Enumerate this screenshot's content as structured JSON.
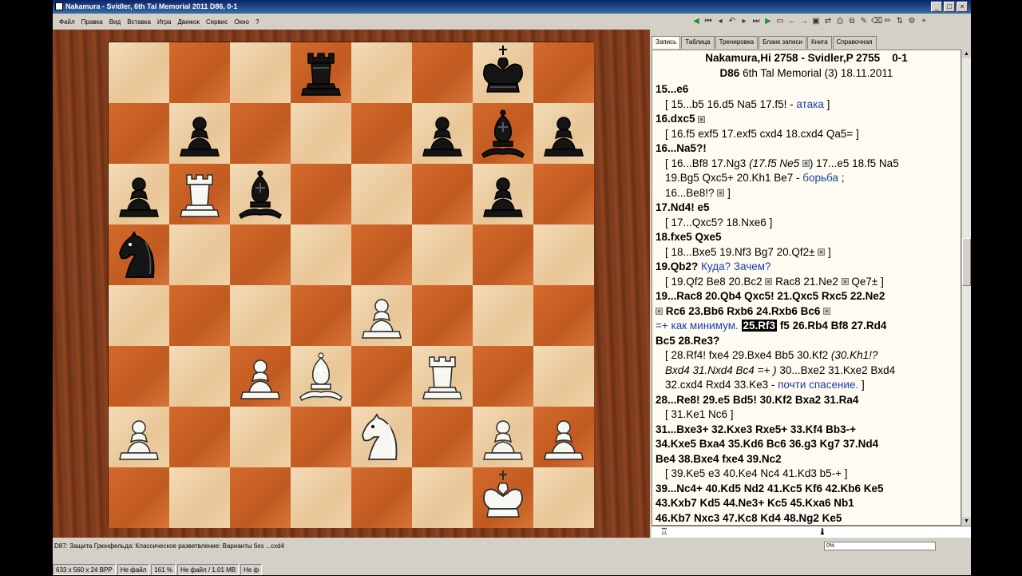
{
  "window": {
    "title": "Nakamura - Svidler, 6th Tal Memorial 2011  D86, 0-1"
  },
  "menu": [
    "Файл",
    "Правка",
    "Вид",
    "Вставка",
    "Игра",
    "Движок",
    "Сервис",
    "Окно",
    "?"
  ],
  "tabs": [
    "Запись",
    "Таблица",
    "Тренировка",
    "Бланк записи",
    "Книга",
    "Справочная"
  ],
  "active_tab": "Запись",
  "game": {
    "white": "Nakamura,Hi 2758",
    "black": "Svidler,P 2755",
    "result": "0-1",
    "eco": "D86",
    "event": "6th Tal Memorial (3) 18.11.2011"
  },
  "notation": {
    "l01": "15...e6",
    "l02a": "[ 15...b5  16.d5  Na5  17.f5! - ",
    "l02b": "атака",
    "l02c": " ]",
    "l03": "16.dxc5",
    "l04": "[ 16.f5  exf5  17.exf5  cxd4  18.cxd4  Qa5= ]",
    "l05": "16...Na5?!",
    "l06a": "[ 16...Bf8  17.Ng3 ",
    "l06b": " (17.f5  Ne5 ",
    "l06c": ") 17...e5  18.f5  Na5",
    "l07a": "19.Bg5  Qxc5+  20.Kh1  Be7 - ",
    "l07b": "борьба",
    "l07c": " ;",
    "l08": "16...Be8!? ",
    "l08b": " ]",
    "l09": "17.Nd4!  e5",
    "l10": "[ 17...Qxc5?  18.Nxe6 ]",
    "l11": "18.fxe5  Qxe5",
    "l12": "[ 18...Bxe5  19.Nf3  Bg7  20.Qf2± ",
    "l12b": " ]",
    "l13a": "19.Qb2? ",
    "l13b": "Куда? Зачем?",
    "l14a": "[ 19.Qf2  Be8  20.Bc2 ",
    "l14b": " Rac8  21.Ne2 ",
    "l14c": " Qe7± ]",
    "l15": "19...Rac8  20.Qb4  Qxc5!  21.Qxc5  Rxc5  22.Ne2",
    "l16": " Rc6  23.Bb6  Rxb6  24.Rxb6  Bc6 ",
    "l17a": "=+ как минимум. ",
    "l17b": "25.Rf3",
    "l17c": "  f5  26.Rb4  Bf8  27.Rd4",
    "l18": "Bc5  28.Re3?",
    "l19": "[ 28.Rf4!  fxe4  29.Bxe4  Bb5  30.Kf2 ",
    "l19b": "(30.Kh1!?",
    "l20a": "Bxd4  31.Nxd4  Bc4 =+ )",
    "l20b": " 30...Bxe2  31.Kxe2  Bxd4",
    "l21a": "32.cxd4  Rxd4  33.Ke3 - ",
    "l21b": "почти спасение.",
    "l21c": " ]",
    "l22": "28...Re8!  29.e5  Bd5!  30.Kf2  Bxa2  31.Ra4",
    "l23": "[ 31.Ke1  Nc6 ]",
    "l24": "31...Bxe3+  32.Kxe3  Rxe5+  33.Kf4  Bb3-+",
    "l25": "34.Kxe5  Bxa4  35.Kd6  Bc6  36.g3  Kg7  37.Nd4",
    "l26": "Be4  38.Bxe4  fxe4  39.Nc2",
    "l27": "[ 39.Ke5  e3  40.Ke4  Nc4  41.Kd3  b5-+ ]",
    "l28": "39...Nc4+  40.Kd5  Nd2  41.Kc5  Kf6  42.Kb6  Ke5",
    "l29": "43.Kxb7  Kd5  44.Ne3+  Kc5  45.Kxa6  Nb1",
    "l30": "46.Kb7  Nxc3  47.Kc8  Kd4  48.Ng2  Ke5"
  },
  "status": {
    "opening": "D87: Защита Грюнфельда: Классическое разветвление: Варианты без ...cxd4",
    "progress": "0%",
    "image_info": "633 x 560 x 24 BPP",
    "file1": "Не файл",
    "zoom": "161 %",
    "file2": "Не файл / 1.01 MB",
    "file3": "Не ф"
  },
  "board": {
    "light_color": "#f0d4aa",
    "dark_color": "#cf6428",
    "pieces": [
      {
        "square": "d8",
        "piece": "bR"
      },
      {
        "square": "g8",
        "piece": "bK"
      },
      {
        "square": "b7",
        "piece": "bP"
      },
      {
        "square": "f7",
        "piece": "bP"
      },
      {
        "square": "g7",
        "piece": "bB"
      },
      {
        "square": "h7",
        "piece": "bP"
      },
      {
        "square": "a6",
        "piece": "bP"
      },
      {
        "square": "b6",
        "piece": "wR"
      },
      {
        "square": "c6",
        "piece": "bB"
      },
      {
        "square": "g6",
        "piece": "bP"
      },
      {
        "square": "a5",
        "piece": "bN"
      },
      {
        "square": "e4",
        "piece": "wP"
      },
      {
        "square": "c3",
        "piece": "wP"
      },
      {
        "square": "d3",
        "piece": "wB"
      },
      {
        "square": "f3",
        "piece": "wR"
      },
      {
        "square": "a2",
        "piece": "wP"
      },
      {
        "square": "e2",
        "piece": "wN"
      },
      {
        "square": "g2",
        "piece": "wP"
      },
      {
        "square": "h2",
        "piece": "wP"
      },
      {
        "square": "g1",
        "piece": "wK"
      }
    ]
  }
}
